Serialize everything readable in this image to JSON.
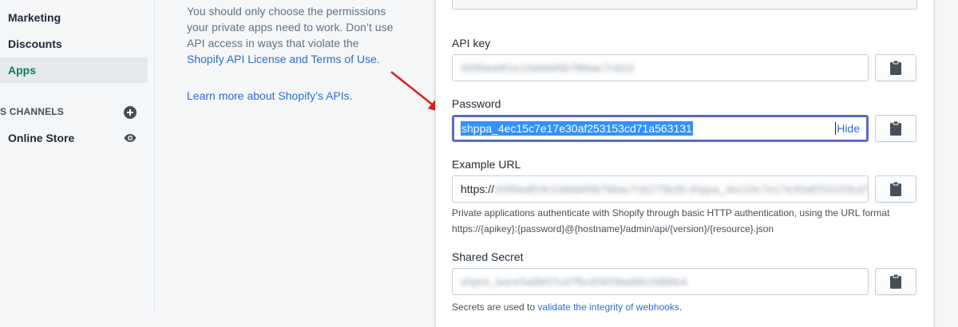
{
  "sidebar": {
    "items": [
      {
        "label": "Marketing"
      },
      {
        "label": "Discounts"
      },
      {
        "label": "Apps"
      }
    ],
    "channels_heading": "S CHANNELS",
    "channels": [
      {
        "label": "Online Store"
      }
    ]
  },
  "description": {
    "text": "You should only choose the permissions your private apps need to work. Don’t use API access in ways that violate the ",
    "link": "Shopify API License and Terms of Use",
    "suffix": ".",
    "learn_more": "Learn more about Shopify’s APIs."
  },
  "form": {
    "api_key": {
      "label": "API key",
      "value": "0095ed4f1e10ddd45b7f86ac7cb2d"
    },
    "password": {
      "label": "Password",
      "value": "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",
      "hide_label": "Hide"
    },
    "example_url": {
      "label": "Example URL",
      "prefix": "https://",
      "value": "0095edf1fe10ddd45b786ac7cb275b35:shppa_4ec15c7e17e30af253153cd7",
      "help_line1": "Private applications authenticate with Shopify through basic HTTP authentication, using the URL format",
      "help_line2": "https://{apikey}:{password}@{hostname}/admin/api/{version}/{resource}.json"
    },
    "shared_secret": {
      "label": "Shared Secret",
      "value": "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",
      "help_prefix": "Secrets are used to ",
      "help_link": "validate the integrity of webhooks",
      "help_suffix": "."
    }
  },
  "colors": {
    "accent": "#008060",
    "link": "#2c6ecb",
    "focus": "#5c6ac4",
    "annotation_arrow": "#e01b1b"
  },
  "icons": [
    "plus-circle-icon",
    "eye-icon",
    "clipboard-icon",
    "red-arrow-annotation"
  ]
}
